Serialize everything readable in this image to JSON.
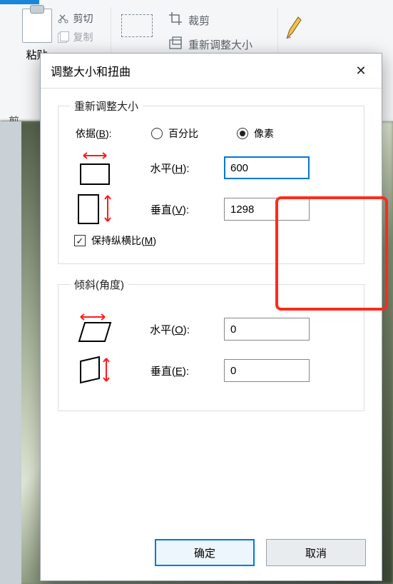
{
  "ribbon": {
    "paste_label": "粘贴",
    "cut_label": "剪切",
    "copy_label": "复制",
    "clipboard_group_label": "剪",
    "crop_label": "裁剪",
    "resize_label": "重新调整大小"
  },
  "dialog": {
    "title": "调整大小和扭曲",
    "resize_group": {
      "legend": "重新调整大小",
      "basis_label": "依据(B):",
      "basis_percent": "百分比",
      "basis_pixels": "像素",
      "basis_selected": "pixels",
      "horizontal_label": "水平(H):",
      "horizontal_value": "600",
      "vertical_label": "垂直(V):",
      "vertical_value": "1298",
      "keep_aspect_label": "保持纵横比(M)",
      "keep_aspect_checked": true
    },
    "skew_group": {
      "legend": "倾斜(角度)",
      "horizontal_label": "水平(O):",
      "horizontal_value": "0",
      "vertical_label": "垂直(E):",
      "vertical_value": "0"
    },
    "ok_label": "确定",
    "cancel_label": "取消"
  }
}
